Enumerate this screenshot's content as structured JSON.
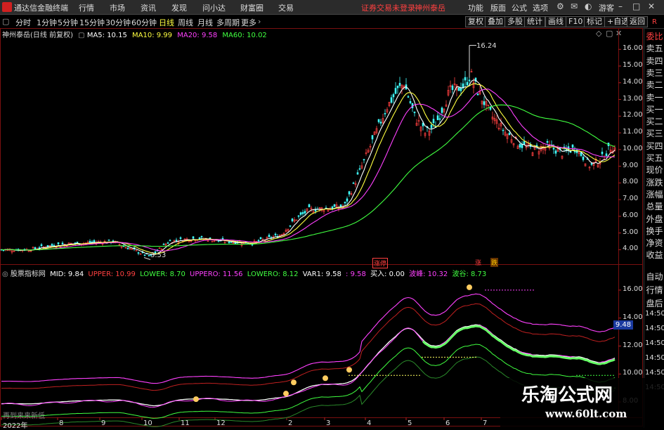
{
  "titlebar": {
    "app_name": "通达信金融终端",
    "menus": [
      "行情",
      "市场",
      "资讯",
      "发现",
      "问小达",
      "财富圈",
      "交易"
    ],
    "alert": "证券交易未登录",
    "stock_name": "神州泰岳",
    "right_menus": [
      "功能",
      "版面",
      "公式",
      "选项"
    ],
    "user": "游客"
  },
  "periods": {
    "items": [
      "分时",
      "1分钟",
      "5分钟",
      "15分钟",
      "30分钟",
      "60分钟",
      "日线",
      "周线",
      "月线",
      "多周期",
      "更多"
    ],
    "active": "日线"
  },
  "toolbar": [
    "复权",
    "叠加",
    "多股",
    "统计",
    "画线",
    "F10",
    "标记",
    "+自选",
    "返回"
  ],
  "main_chart": {
    "title": "神州泰岳(日线 前复权)",
    "ma": [
      {
        "label": "MA5: 10.15",
        "color": "#ffffff"
      },
      {
        "label": "MA10: 9.99",
        "color": "#ffff40"
      },
      {
        "label": "MA20: 9.58",
        "color": "#ff40ff"
      },
      {
        "label": "MA60: 10.02",
        "color": "#40ff40"
      }
    ],
    "y_ticks": [
      "16.00",
      "15.00",
      "14.00",
      "13.00",
      "12.00",
      "11.00",
      "10.00",
      "9.00",
      "8.00",
      "7.00",
      "6.00",
      "5.00",
      "4.00"
    ],
    "high_label": "16.24",
    "low_label": "3.53",
    "event_labels": [
      "涨停",
      "涨",
      "跌"
    ]
  },
  "indicator": {
    "name": "股票指标网",
    "fields": [
      {
        "label": "MID: 9.84",
        "color": "#ffffff"
      },
      {
        "label": "UPPER: 10.99",
        "color": "#ff4040"
      },
      {
        "label": "LOWER: 8.70",
        "color": "#40ff40"
      },
      {
        "label": "UPPERO: 11.56",
        "color": "#ff40ff"
      },
      {
        "label": "LOWERO: 8.12",
        "color": "#40ff40"
      },
      {
        "label": "VAR1: 9.58",
        "color": "#ffffff"
      },
      {
        "label": ": 9.58",
        "color": "#ff40ff"
      },
      {
        "label": "买入: 0.00",
        "color": "#ffffff"
      },
      {
        "label": "波峰: 10.32",
        "color": "#ff40ff"
      },
      {
        "label": "波谷: 8.73",
        "color": "#40ff40"
      }
    ],
    "y_ticks": [
      "16.00",
      "14.00",
      "12.00",
      "10.00",
      "8.00"
    ],
    "value_box": "9.48",
    "footer": "再到来来新低"
  },
  "x_axis": [
    "2022年",
    "8",
    "9",
    "10",
    "11",
    "12",
    "2",
    "3",
    "4",
    "5",
    "6",
    "7"
  ],
  "right_sidebar": {
    "top_labels": [
      "委比",
      "卖五",
      "卖四",
      "卖三",
      "卖二",
      "卖一",
      "买一",
      "买二",
      "买三",
      "买四",
      "买五",
      "现价",
      "涨跌",
      "涨幅",
      "总量",
      "外盘",
      "换手",
      "净资",
      "收益"
    ],
    "bottom_labels": [
      "自动",
      "行情",
      "盘后"
    ],
    "times": [
      "14:50",
      "14:50",
      "14:50",
      "14:50",
      "14:50",
      "14:50"
    ],
    "top_marker": "R"
  },
  "watermark": {
    "title": "乐淘公式网",
    "url": "www.60lt.com"
  },
  "colors": {
    "up": "#ff4040",
    "down": "#40ffff",
    "ma5": "#ffffff",
    "ma10": "#ffff40",
    "ma20": "#ff40ff",
    "ma60": "#40ff40"
  }
}
